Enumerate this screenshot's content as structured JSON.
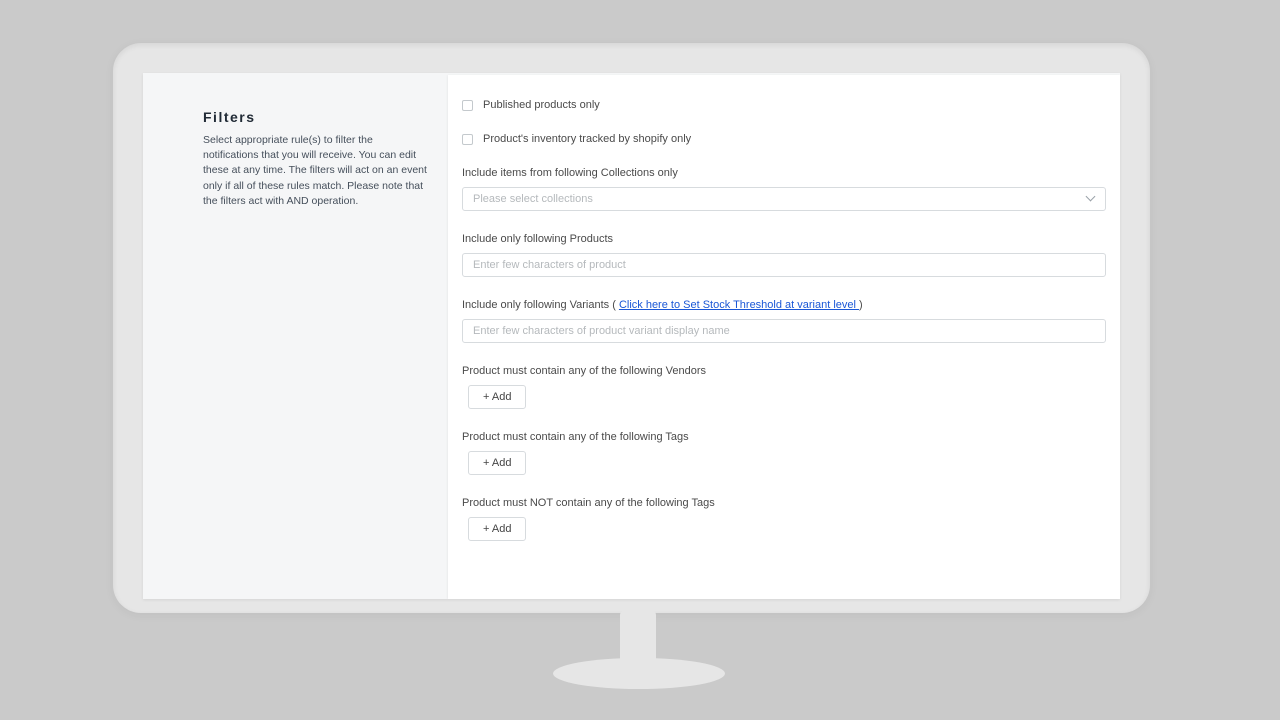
{
  "sidebar": {
    "title": "Filters",
    "description": "Select appropriate rule(s) to filter the notifications that you will receive. You can edit these at any time. The filters will act on an event only if all of these rules match. Please note that the filters act with AND operation."
  },
  "checkboxes": {
    "published": "Published products only",
    "tracked": "Product's inventory tracked by shopify only"
  },
  "collections": {
    "label": "Include items from following Collections only",
    "placeholder": "Please select collections"
  },
  "products": {
    "label": "Include only following Products",
    "placeholder": "Enter few characters of product"
  },
  "variants": {
    "label_prefix": "Include only following Variants ( ",
    "link_text": "Click here to Set Stock Threshold at variant level ",
    "label_suffix": ")",
    "placeholder": "Enter few characters of product variant display name"
  },
  "vendors": {
    "label": "Product must contain any of the following Vendors",
    "button": "+ Add"
  },
  "tags_include": {
    "label": "Product must contain any of the following Tags",
    "button": "+ Add"
  },
  "tags_exclude": {
    "label": "Product must NOT contain any of the following Tags",
    "button": "+ Add"
  }
}
